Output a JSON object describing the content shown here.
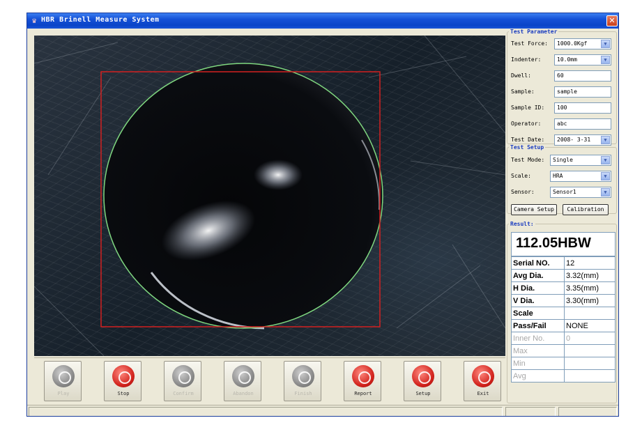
{
  "window": {
    "title": "HBR Brinell Measure System",
    "close_symbol": "✕"
  },
  "test_parameter": {
    "legend": "Test Parameter",
    "fields": [
      {
        "label": "Test Force:",
        "value": "1000.0Kgf",
        "type": "combo"
      },
      {
        "label": "Indenter:",
        "value": "10.0mm",
        "type": "combo"
      },
      {
        "label": "Dwell:",
        "value": "60",
        "type": "text"
      },
      {
        "label": "Sample:",
        "value": "sample",
        "type": "text"
      },
      {
        "label": "Sample ID:",
        "value": "100",
        "type": "text"
      },
      {
        "label": "Operator:",
        "value": "abc",
        "type": "text"
      },
      {
        "label": "Test Date:",
        "value": "2008- 3-31",
        "type": "combo"
      }
    ]
  },
  "test_setup": {
    "legend": "Test Setup",
    "fields": [
      {
        "label": "Test Mode:",
        "value": "Single"
      },
      {
        "label": "Scale:",
        "value": "HRA"
      },
      {
        "label": "Sensor:",
        "value": "Sensor1"
      }
    ],
    "buttons": {
      "camera": "Camera Setup",
      "calibration": "Calibration"
    }
  },
  "result": {
    "legend": "Result:",
    "hardness": "112.05HBW",
    "rows": [
      {
        "key": "Serial NO.",
        "value": "12",
        "active": true
      },
      {
        "key": "Avg Dia.",
        "value": "3.32(mm)",
        "active": true
      },
      {
        "key": "H Dia.",
        "value": "3.35(mm)",
        "active": true
      },
      {
        "key": "V Dia.",
        "value": "3.30(mm)",
        "active": true
      },
      {
        "key": "Scale",
        "value": "",
        "active": true
      },
      {
        "key": "Pass/Fail",
        "value": "NONE",
        "active": true
      },
      {
        "key": "Inner No.",
        "value": "0",
        "active": false
      },
      {
        "key": "Max",
        "value": "",
        "active": false
      },
      {
        "key": "Min",
        "value": "",
        "active": false
      },
      {
        "key": "Avg",
        "value": "",
        "active": false
      }
    ]
  },
  "toolbar": [
    {
      "label": "Play",
      "icon": "play-icon",
      "color": "gray",
      "enabled": false
    },
    {
      "label": "Stop",
      "icon": "stop-icon",
      "color": "red",
      "enabled": true
    },
    {
      "label": "Confirm",
      "icon": "confirm-icon",
      "color": "gray",
      "enabled": false
    },
    {
      "label": "Abandon",
      "icon": "abandon-icon",
      "color": "gray",
      "enabled": false
    },
    {
      "label": "Finish",
      "icon": "finish-icon",
      "color": "gray",
      "enabled": false
    },
    {
      "label": "Report",
      "icon": "report-icon",
      "color": "red",
      "enabled": true
    },
    {
      "label": "Setup",
      "icon": "gear-icon",
      "color": "red",
      "enabled": true
    },
    {
      "label": "Exit",
      "icon": "power-icon",
      "color": "red",
      "enabled": true
    }
  ],
  "colors": {
    "roi_box": "#d42020",
    "indent_outline": "#7fd77f",
    "title_bar": "#0a44c8",
    "legend": "#1a3cc0"
  }
}
